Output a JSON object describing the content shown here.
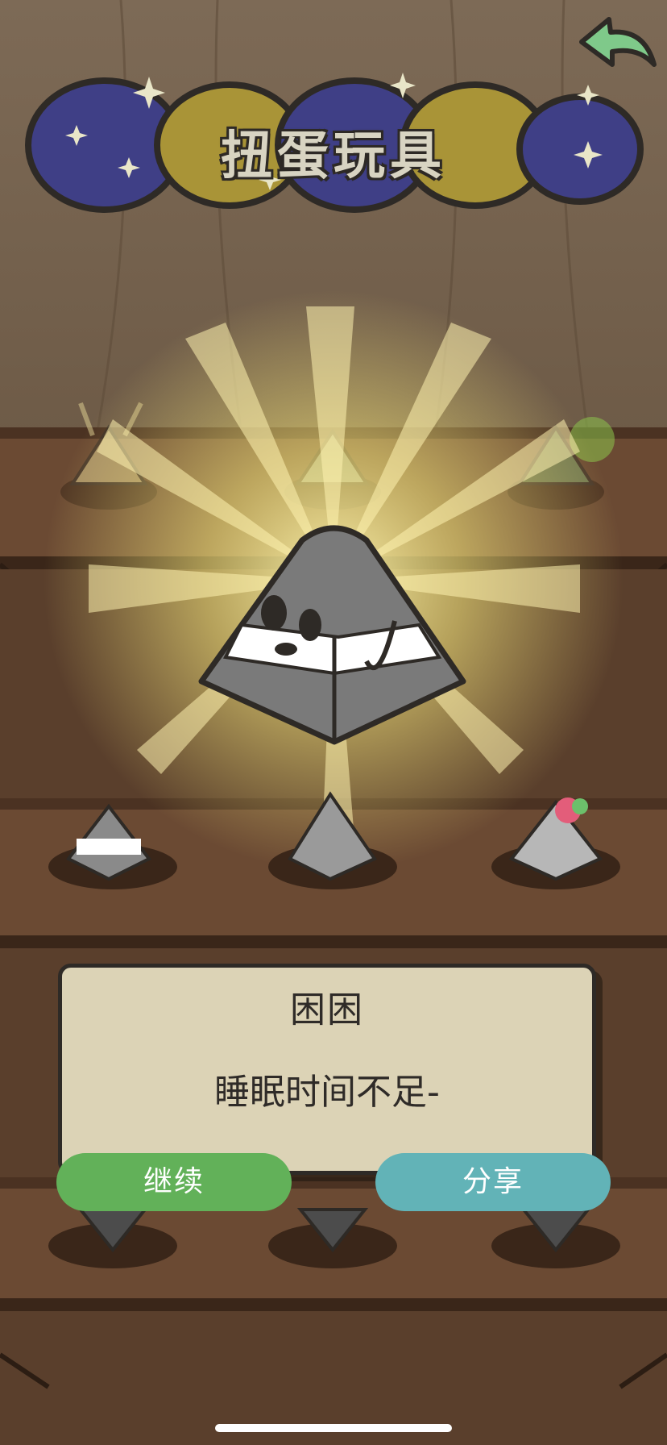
{
  "header": {
    "title": "扭蛋玩具"
  },
  "dialog": {
    "title": "困困",
    "message": "睡眠时间不足-"
  },
  "buttons": {
    "continue_label": "继续",
    "share_label": "分享"
  },
  "colors": {
    "continue": "#62b159",
    "share": "#62b3b7",
    "back_arrow": "#7fc98a",
    "shelf": "#6b4a33",
    "wall": "#7a6651"
  },
  "icons": {
    "back": "back-arrow-icon"
  }
}
